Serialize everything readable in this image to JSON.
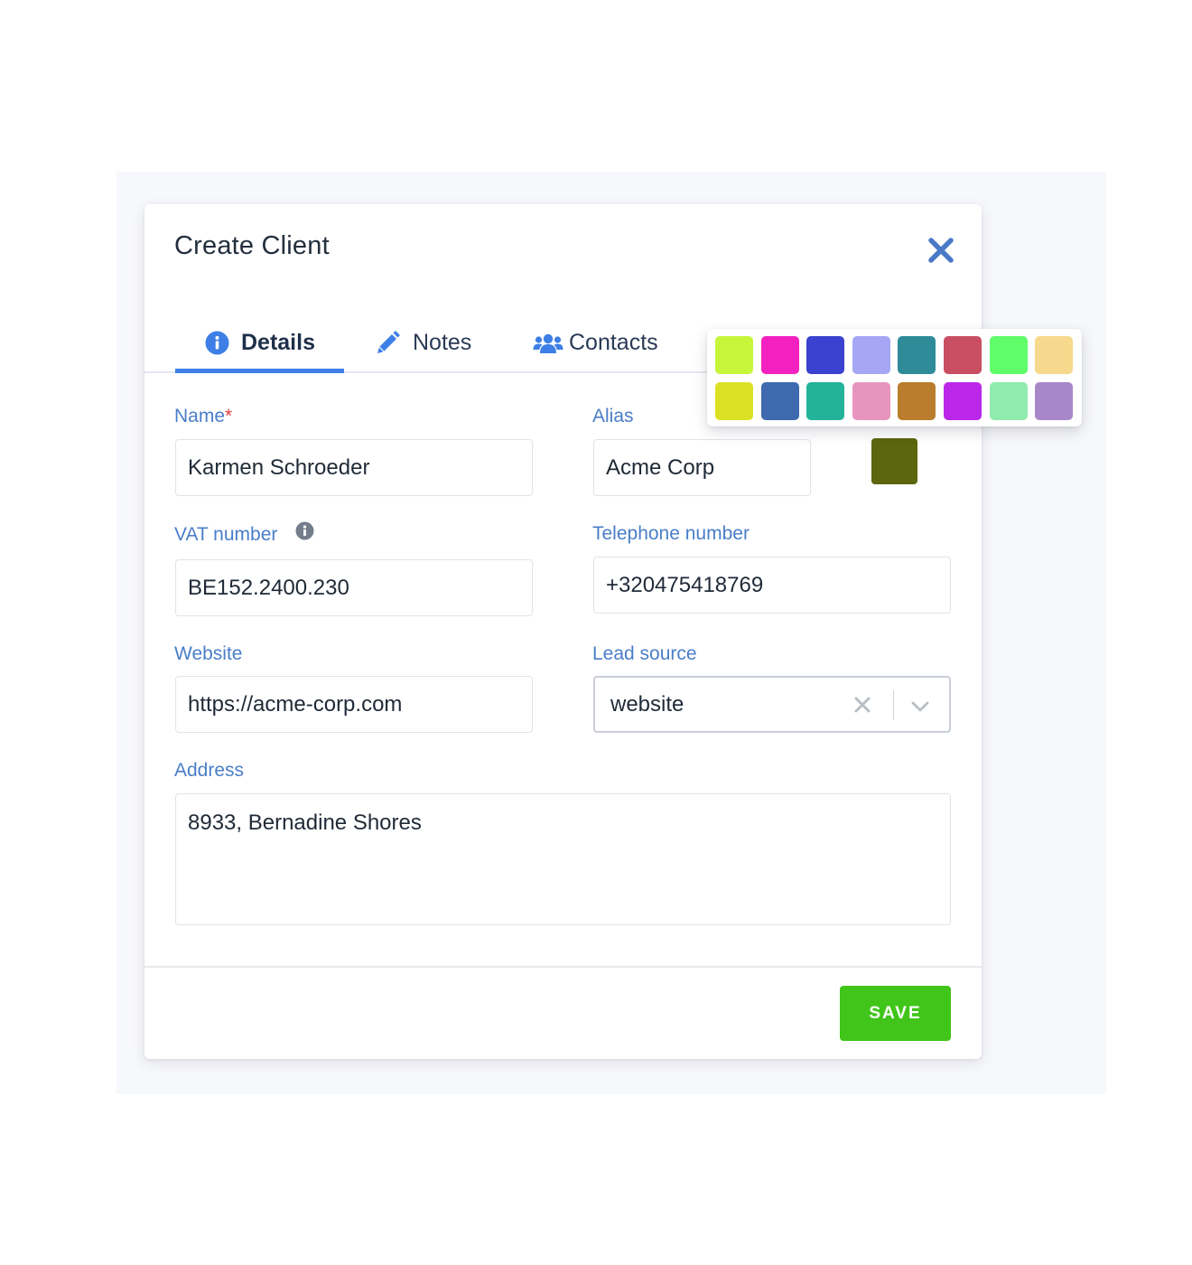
{
  "dialog": {
    "title": "Create Client",
    "close_icon": "close-x-icon"
  },
  "tabs": [
    {
      "label": "Details",
      "icon": "info-circle-icon",
      "active": true
    },
    {
      "label": "Notes",
      "icon": "pencil-icon",
      "active": false
    },
    {
      "label": "Contacts",
      "icon": "users-icon",
      "active": false
    }
  ],
  "form": {
    "name": {
      "label": "Name",
      "required_mark": "*",
      "value": "Karmen Schroeder"
    },
    "alias": {
      "label": "Alias",
      "value": "Acme Corp",
      "selected_color": "#5c660e"
    },
    "vat": {
      "label": "VAT number",
      "value": "BE152.2400.230",
      "icon": "info-circle-icon"
    },
    "telephone": {
      "label": "Telephone number",
      "value": "+320475418769"
    },
    "website": {
      "label": "Website",
      "value": "https://acme-corp.com"
    },
    "lead_source": {
      "label": "Lead source",
      "value": "website"
    },
    "address": {
      "label": "Address",
      "value": "8933, Bernadine Shores"
    }
  },
  "actions": {
    "save_label": "SAVE"
  },
  "palette": {
    "colors": [
      "#c7f53a",
      "#f321bf",
      "#3b42cf",
      "#a5a7f5",
      "#2f8b98",
      "#c94e62",
      "#60fc6a",
      "#f6d98d",
      "#dde126",
      "#3f6aaf",
      "#23b39b",
      "#e795be",
      "#b97d2d",
      "#bb27e8",
      "#90ecae",
      "#a887c9"
    ]
  },
  "theme": {
    "accent": "#3d7fe6",
    "label_color": "#4a7ec8",
    "save_color": "#41c51a"
  }
}
